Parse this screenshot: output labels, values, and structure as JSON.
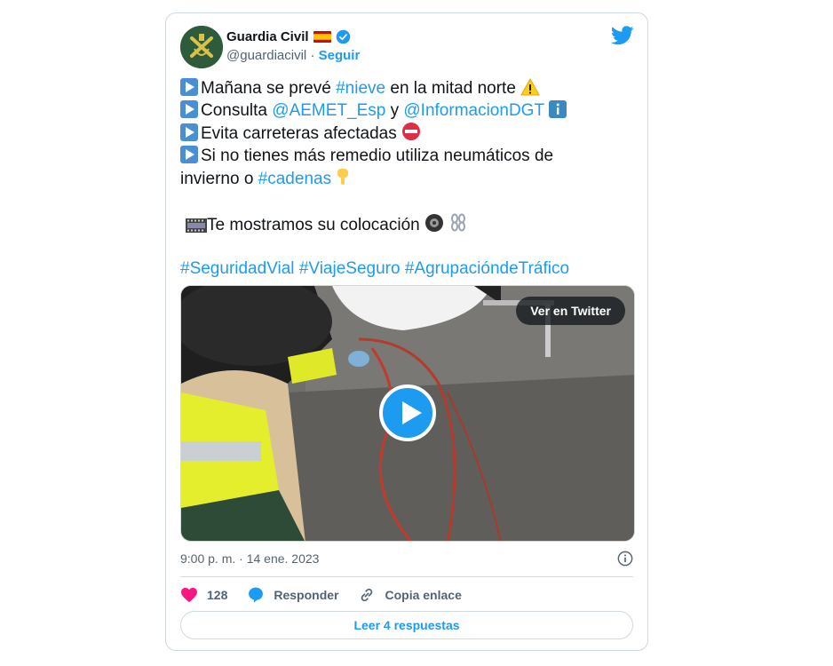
{
  "colors": {
    "accent": "#1d9bf0",
    "text": "#0f1419",
    "muted": "#536471",
    "heart": "#f91880",
    "border": "#cfd9de"
  },
  "author": {
    "name": "Guardia Civil",
    "handle": "@guardiacivil",
    "separator": "·",
    "follow_label": "Seguir"
  },
  "icons": {
    "brand": "twitter-bird-icon",
    "flag": "spain-flag-icon",
    "verified": "verified-badge-icon"
  },
  "tweet": {
    "line1": {
      "pre": "Mañana se prevé ",
      "hashtag": "#nieve",
      "post": " en la mitad norte"
    },
    "line2": {
      "pre": "Consulta ",
      "mention1": "@AEMET_Esp",
      "mid": " y ",
      "mention2": "@InformacionDGT"
    },
    "line3": {
      "text": "Evita carreteras afectadas"
    },
    "line4": {
      "text": "Si no tienes más remedio utiliza neumáticos de"
    },
    "line5": {
      "pre": "invierno o ",
      "hashtag": "#cadenas"
    },
    "line6": {
      "text": "Te mostramos su colocación"
    },
    "hashtags": [
      "#SeguridadVial",
      "#ViajeSeguro",
      "#AgrupacióndeTráfico"
    ]
  },
  "media": {
    "overlay_button": "Ver en Twitter"
  },
  "meta": {
    "timestamp": "9:00 p. m. · 14 ene. 2023"
  },
  "actions": {
    "likes": "128",
    "reply_label": "Responder",
    "copy_label": "Copia enlace"
  },
  "read_replies": "Leer 4 respuestas"
}
